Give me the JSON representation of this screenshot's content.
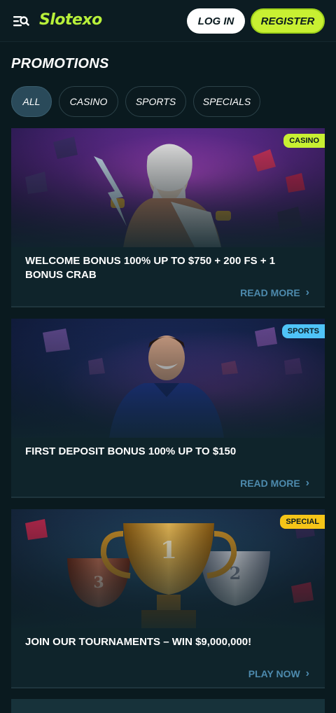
{
  "header": {
    "logo_text": "Slotexo",
    "login_label": "LOG IN",
    "register_label": "REGISTER"
  },
  "page": {
    "title": "PROMOTIONS"
  },
  "filters": [
    {
      "label": "ALL",
      "active": true
    },
    {
      "label": "CASINO",
      "active": false
    },
    {
      "label": "SPORTS",
      "active": false
    },
    {
      "label": "SPECIALS",
      "active": false
    }
  ],
  "promos": [
    {
      "badge": "CASINO",
      "badge_color": "#c8f032",
      "title": "WELCOME BONUS 100% UP TO $750 + 200 FS + 1 BONUS CRAB",
      "cta": "READ MORE",
      "image": "zeus-lightning"
    },
    {
      "badge": "SPORTS",
      "badge_color": "#4fc3f7",
      "title": "FIRST DEPOSIT BONUS 100% UP TO $150",
      "cta": "READ MORE",
      "image": "footballer-portrait"
    },
    {
      "badge": "SPECIAL",
      "badge_color": "#f5c518",
      "title": "JOIN OUR TOURNAMENTS – WIN $9,000,000!",
      "cta": "PLAY NOW",
      "image": "trophy-cups"
    }
  ]
}
